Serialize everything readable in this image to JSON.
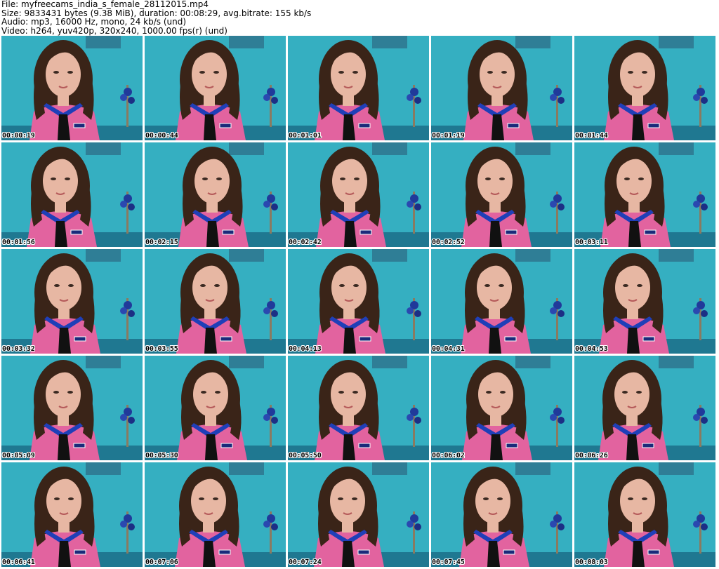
{
  "file_info": {
    "file": "File: myfreecams_india_s_female_28112015.mp4",
    "size": "Size: 9833431 bytes (9.38 MiB), duration: 00:08:29, avg.bitrate: 155 kb/s",
    "audio": "Audio: mp3, 16000 Hz, mono, 24 kb/s (und)",
    "video": "Video: h264, yuv420p, 320x240, 1000.00 fps(r) (und)"
  },
  "thumbnails": [
    {
      "timestamp": "00:00:19"
    },
    {
      "timestamp": "00:00:44"
    },
    {
      "timestamp": "00:01:01"
    },
    {
      "timestamp": "00:01:19"
    },
    {
      "timestamp": "00:01:44"
    },
    {
      "timestamp": "00:01:56"
    },
    {
      "timestamp": "00:02:15"
    },
    {
      "timestamp": "00:02:42"
    },
    {
      "timestamp": "00:02:52"
    },
    {
      "timestamp": "00:03:11"
    },
    {
      "timestamp": "00:03:32"
    },
    {
      "timestamp": "00:03:55"
    },
    {
      "timestamp": "00:04:13"
    },
    {
      "timestamp": "00:04:31"
    },
    {
      "timestamp": "00:04:53"
    },
    {
      "timestamp": "00:05:09"
    },
    {
      "timestamp": "00:05:30"
    },
    {
      "timestamp": "00:05:50"
    },
    {
      "timestamp": "00:06:02"
    },
    {
      "timestamp": "00:06:26"
    },
    {
      "timestamp": "00:06:41"
    },
    {
      "timestamp": "00:07:06"
    },
    {
      "timestamp": "00:07:24"
    },
    {
      "timestamp": "00:07:45"
    },
    {
      "timestamp": "00:08:03"
    }
  ],
  "colors": {
    "background": "#39b3c5",
    "shirt": "#e2639f",
    "collar": "#1f3fb8",
    "bow": "#111111",
    "hair": "#3a2418",
    "skin": "#e7b7a3"
  }
}
